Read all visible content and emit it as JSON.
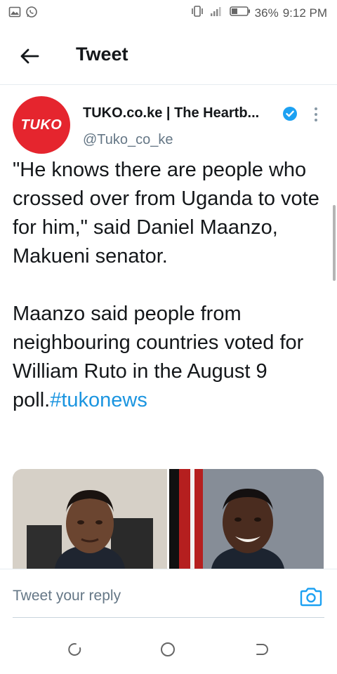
{
  "status_bar": {
    "battery": "36%",
    "time": "9:12 PM"
  },
  "header": {
    "title": "Tweet"
  },
  "tweet": {
    "avatar_text": "TUKO",
    "author_name": "TUKO.co.ke | The Heartb...",
    "author_handle": "@Tuko_co_ke",
    "paragraph_1": "\"He knows there are people who crossed over from Uganda to vote for him,\" said Daniel Maanzo, Makueni senator.",
    "paragraph_2": "Maanzo said people from neighbouring countries voted for William Ruto in the August 9 poll.",
    "hashtag": "#tukonews"
  },
  "reply": {
    "placeholder": "Tweet your reply"
  },
  "colors": {
    "brand_red": "#e5252e",
    "link_blue": "#1b95e0",
    "verified_blue": "#1da1f2"
  }
}
